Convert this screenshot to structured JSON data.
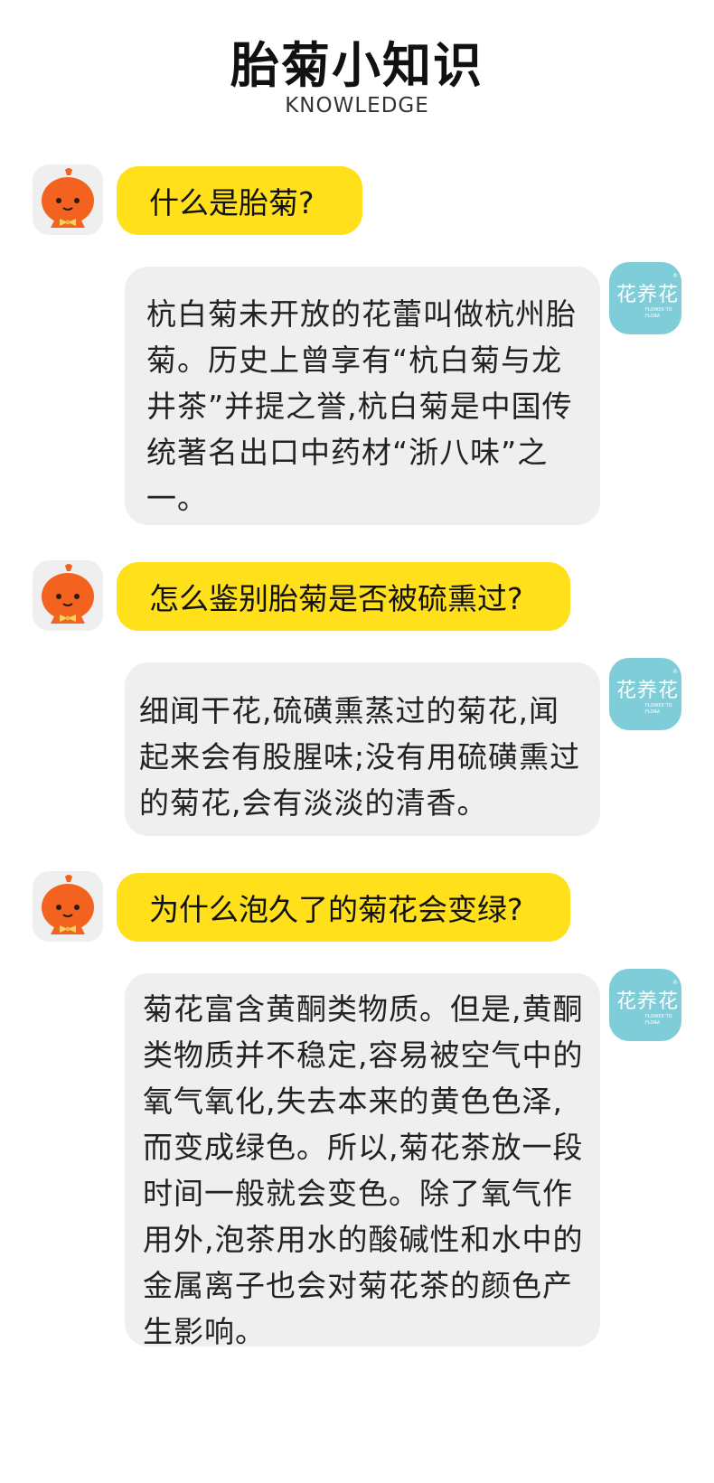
{
  "header": {
    "title": "胎菊小知识",
    "subtitle": "KNOWLEDGE"
  },
  "logo": {
    "text": "花养花",
    "subtext": "FLOWER TO\nFLORA",
    "mark": "®",
    "color": "#7fcdd9"
  },
  "avatar": {
    "icon": "pumpkin-mascot-icon",
    "color": "#f4621f"
  },
  "colors": {
    "question_bg": "#ffe01b",
    "answer_bg": "#efefef"
  },
  "qa": [
    {
      "question": "什么是胎菊?",
      "answer": "杭白菊未开放的花蕾叫做杭州胎菊。历史上曾享有“杭白菊与龙井茶”并提之誉,杭白菊是中国传统著名出口中药材“浙八味”之一。"
    },
    {
      "question": "怎么鉴别胎菊是否被硫熏过?",
      "answer": "细闻干花,硫磺熏蒸过的菊花,闻起来会有股腥味;没有用硫磺熏过的菊花,会有淡淡的清香。"
    },
    {
      "question": "为什么泡久了的菊花会变绿?",
      "answer": "菊花富含黄酮类物质。但是,黄酮类物质并不稳定,容易被空气中的氧气氧化,失去本来的黄色色泽,而变成绿色。所以,菊花茶放一段时间一般就会变色。除了氧气作用外,泡茶用水的酸碱性和水中的金属离子也会对菊花茶的颜色产生影响。"
    }
  ]
}
